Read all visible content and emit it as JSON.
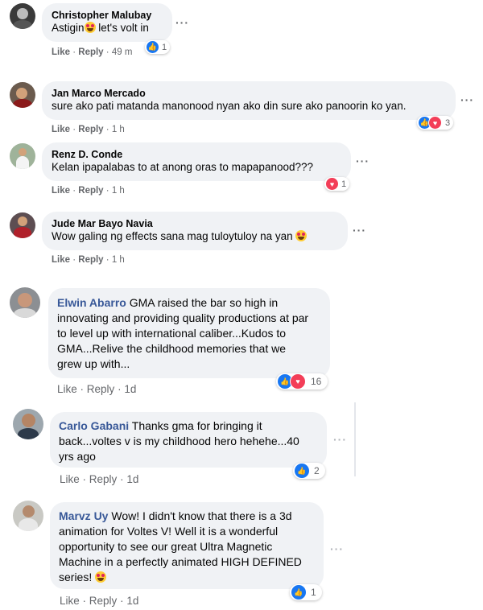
{
  "comments": [
    {
      "name": "Christopher Malubay",
      "text": "Astigin",
      "text_after": " let's volt in",
      "like_label": "Like",
      "reply_label": "Reply",
      "time": "49 m",
      "reaction_count": "1"
    },
    {
      "name": "Jan Marco Mercado",
      "text": "sure ako pati matanda manonood nyan ako din sure ako panoorin ko yan.",
      "like_label": "Like",
      "reply_label": "Reply",
      "time": "1 h",
      "reaction_count": "3"
    },
    {
      "name": "Renz D. Conde",
      "text": "Kelan ipapalabas to at anong oras to mapapanood???",
      "like_label": "Like",
      "reply_label": "Reply",
      "time": "1 h",
      "reaction_count": "1"
    },
    {
      "name": "Jude Mar Bayo Navia",
      "text": "Wow galing ng effects sana mag tuloytuloy na yan",
      "like_label": "Like",
      "reply_label": "Reply",
      "time": "1 h"
    },
    {
      "name": "Elwin Abarro",
      "line1": "GMA raised the bar so high in",
      "line2": "innovating and providing quality productions at par",
      "line3": "to level up with international caliber...Kudos to",
      "line4": "GMA...Relive the childhood memories that we",
      "line5": "grew up with...",
      "like_label": "Like",
      "reply_label": "Reply",
      "time": "1d",
      "reaction_count": "16"
    },
    {
      "name": "Carlo Gabani",
      "line1": "Thanks gma for bringing it",
      "line2": "back...voltes v is my childhood hero hehehe...40",
      "line3": "yrs ago",
      "like_label": "Like",
      "reply_label": "Reply",
      "time": "1d",
      "reaction_count": "2"
    },
    {
      "name": "Marvz Uy",
      "line1": "Wow! I didn't know that there is a 3d",
      "line2": "animation for Voltes V! Well it is a wonderful",
      "line3": "opportunity to see our great Ultra Magnetic",
      "line4": "Machine in a perfectly animated HIGH DEFINED",
      "line5": "series!",
      "like_label": "Like",
      "reply_label": "Reply",
      "time": "1d",
      "reaction_count": "1"
    }
  ],
  "separator": "·",
  "more_glyph": "···",
  "icons": {
    "like": "like-icon",
    "love": "love-icon",
    "emoji": "heart-eyes-emoji-icon",
    "more": "more-options-icon"
  },
  "colors": {
    "like": "#1877f2",
    "love": "#f33e58",
    "bubble": "#f0f2f5",
    "meta": "#65676b"
  }
}
